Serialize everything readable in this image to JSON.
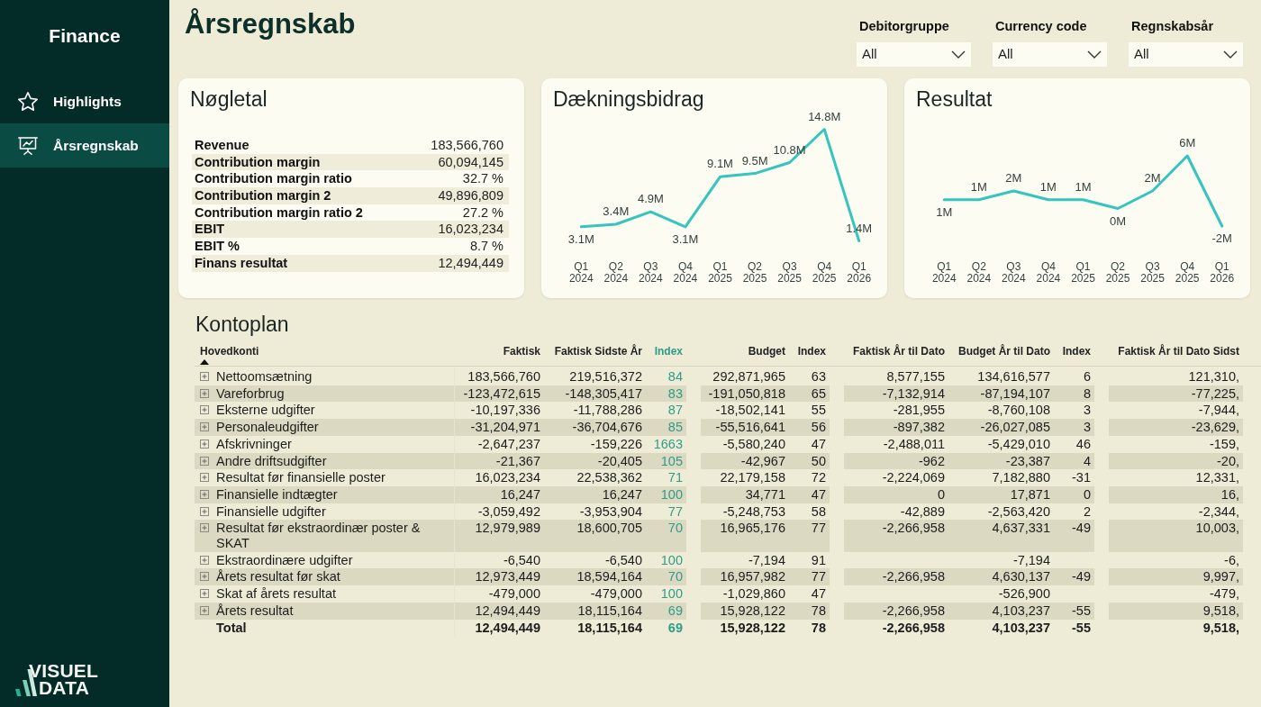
{
  "sidebar": {
    "title": "Finance",
    "items": [
      {
        "label": "Highlights",
        "selected": false
      },
      {
        "label": "Årsregnskab",
        "selected": true
      }
    ],
    "logo": {
      "lines": [
        "VISUEL",
        "DATA"
      ]
    }
  },
  "page": {
    "title": "Årsregnskab"
  },
  "filters": [
    {
      "label": "Debitorgruppe",
      "value": "All"
    },
    {
      "label": "Currency code",
      "value": "All"
    },
    {
      "label": "Regnskabsår",
      "value": "All"
    }
  ],
  "key_figures": {
    "title": "Nøgletal",
    "rows": [
      {
        "label": "Revenue",
        "value": "183,566,760"
      },
      {
        "label": "Contribution margin",
        "value": "60,094,145"
      },
      {
        "label": "Contribution margin ratio",
        "value": "32.7 %"
      },
      {
        "label": "Contribution margin 2",
        "value": "49,896,809"
      },
      {
        "label": "Contribution margin ratio 2",
        "value": "27.2 %"
      },
      {
        "label": "EBIT",
        "value": "16,023,234"
      },
      {
        "label": "EBIT %",
        "value": "8.7 %"
      },
      {
        "label": "Finans resultat",
        "value": "12,494,449"
      }
    ]
  },
  "contribution_chart": {
    "chart_data": {
      "type": "line",
      "title": "Dækningsbidrag",
      "categories": [
        "Q1 2024",
        "Q2 2024",
        "Q3 2024",
        "Q4 2024",
        "Q1 2025",
        "Q2 2025",
        "Q3 2025",
        "Q4 2025",
        "Q1 2026"
      ],
      "series": [
        {
          "color": "#35c4be",
          "values": [
            3100000,
            3400000,
            4900000,
            3100000,
            9100000,
            9500000,
            10800000,
            14800000,
            1400000
          ],
          "value_labels": [
            "3.1M",
            "3.4M",
            "4.9M",
            "3.1M",
            "9.1M",
            "9.5M",
            "10.8M",
            "14.8M",
            "1.4M"
          ]
        }
      ]
    }
  },
  "result_chart": {
    "chart_data": {
      "type": "line",
      "title": "Resultat",
      "categories": [
        "Q1 2024",
        "Q2 2024",
        "Q3 2024",
        "Q4 2024",
        "Q1 2025",
        "Q2 2025",
        "Q3 2025",
        "Q4 2025",
        "Q1 2026"
      ],
      "series": [
        {
          "color": "#35c4be",
          "values": [
            1000000,
            1000000,
            2000000,
            1000000,
            1000000,
            0,
            2000000,
            6000000,
            -2000000
          ],
          "value_labels": [
            "1M",
            "1M",
            "2M",
            "1M",
            "1M",
            "0M",
            "2M",
            "6M",
            "-2M"
          ]
        }
      ]
    }
  },
  "kontoplan": {
    "title": "Kontoplan",
    "columns": [
      {
        "label": "Hovedkonti",
        "sorted": true
      },
      {
        "label": "Faktisk"
      },
      {
        "label": "Faktisk Sidste År"
      },
      {
        "label": "Index",
        "color": "#2f9c86"
      },
      {
        "label": "Budget"
      },
      {
        "label": "Index"
      },
      {
        "label": "Faktisk År til Dato"
      },
      {
        "label": "Budget År til Dato"
      },
      {
        "label": "Index"
      },
      {
        "label": "Faktisk År til Dato Sidst"
      }
    ],
    "rows": [
      {
        "kind": "account",
        "expanded": false,
        "cells": [
          "Nettoomsætning",
          "183,566,760",
          "219,516,372",
          "84",
          "292,871,965",
          "63",
          "8,577,155",
          "134,616,577",
          "6",
          "121,310,"
        ]
      },
      {
        "kind": "account",
        "expanded": false,
        "cells": [
          "Vareforbrug",
          "-123,472,615",
          "-148,305,417",
          "83",
          "-191,050,818",
          "65",
          "-7,132,914",
          "-87,194,107",
          "8",
          "-77,225,"
        ]
      },
      {
        "kind": "account",
        "expanded": false,
        "cells": [
          "Eksterne udgifter",
          "-10,197,336",
          "-11,788,286",
          "87",
          "-18,502,141",
          "55",
          "-281,955",
          "-8,760,108",
          "3",
          "-7,944,"
        ]
      },
      {
        "kind": "account",
        "expanded": false,
        "cells": [
          "Personaleudgifter",
          "-31,204,971",
          "-36,704,676",
          "85",
          "-55,516,641",
          "56",
          "-897,382",
          "-26,027,085",
          "3",
          "-23,629,"
        ]
      },
      {
        "kind": "account",
        "expanded": false,
        "cells": [
          "Afskrivninger",
          "-2,647,237",
          "-159,226",
          "1663",
          "-5,580,240",
          "47",
          "-2,488,011",
          "-5,429,010",
          "46",
          "-159,"
        ]
      },
      {
        "kind": "account",
        "expanded": false,
        "cells": [
          "Andre driftsudgifter",
          "-21,367",
          "-20,405",
          "105",
          "-42,967",
          "50",
          "-962",
          "-23,387",
          "4",
          "-20,"
        ]
      },
      {
        "kind": "account",
        "expanded": false,
        "cells": [
          "Resultat før finansielle poster",
          "16,023,234",
          "22,538,362",
          "71",
          "22,179,158",
          "72",
          "-2,224,069",
          "7,182,880",
          "-31",
          "12,331,"
        ]
      },
      {
        "kind": "account",
        "expanded": false,
        "cells": [
          "Finansielle indtægter",
          "16,247",
          "16,247",
          "100",
          "34,771",
          "47",
          "0",
          "17,871",
          "0",
          "16,"
        ]
      },
      {
        "kind": "account",
        "expanded": false,
        "cells": [
          "Finansielle udgifter",
          "-3,059,492",
          "-3,953,904",
          "77",
          "-5,248,753",
          "58",
          "-42,889",
          "-2,563,420",
          "2",
          "-2,344,"
        ]
      },
      {
        "kind": "account",
        "expanded": false,
        "cells": [
          "Resultat før ekstraordinær poster & SKAT",
          "12,979,989",
          "18,600,705",
          "70",
          "16,965,176",
          "77",
          "-2,266,958",
          "4,637,331",
          "-49",
          "10,003,"
        ]
      },
      {
        "kind": "account",
        "expanded": false,
        "cells": [
          "Ekstraordinære udgifter",
          "-6,540",
          "-6,540",
          "100",
          "-7,194",
          "91",
          null,
          "-7,194",
          null,
          "-6,"
        ]
      },
      {
        "kind": "account",
        "expanded": false,
        "cells": [
          "Årets resultat før skat",
          "12,973,449",
          "18,594,164",
          "70",
          "16,957,982",
          "77",
          "-2,266,958",
          "4,630,137",
          "-49",
          "9,997,"
        ]
      },
      {
        "kind": "account",
        "expanded": false,
        "cells": [
          "Skat af årets resultat",
          "-479,000",
          "-479,000",
          "100",
          "-1,029,860",
          "47",
          null,
          "-526,900",
          null,
          "-479,"
        ]
      },
      {
        "kind": "account",
        "expanded": false,
        "cells": [
          "Årets resultat",
          "12,494,449",
          "18,115,164",
          "69",
          "15,928,122",
          "78",
          "-2,266,958",
          "4,103,237",
          "-55",
          "9,518,"
        ]
      },
      {
        "kind": "total",
        "cells": [
          "Total",
          "12,494,449",
          "18,115,164",
          "69",
          "15,928,122",
          "78",
          "-2,266,958",
          "4,103,237",
          "-55",
          "9,518,"
        ]
      }
    ]
  }
}
